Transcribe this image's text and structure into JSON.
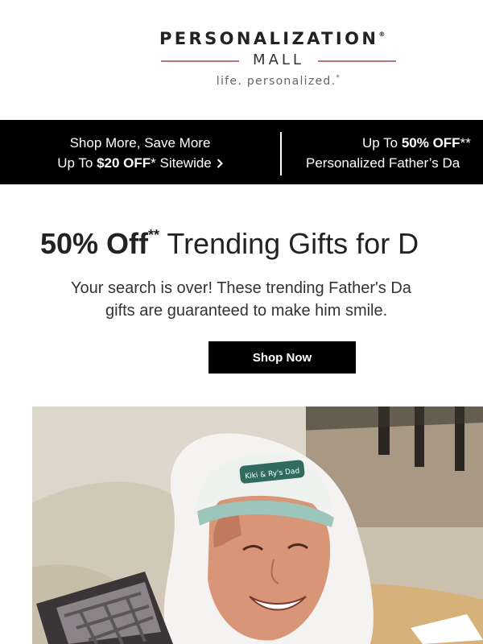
{
  "brand": {
    "name": "PERSONALIZATION",
    "registered_mark": "®",
    "sub": "MALL",
    "tagline": "life. personalized.",
    "tagline_mark": "*",
    "accent_color": "#b9707a"
  },
  "promo_bar": {
    "left_line1": "Shop More, Save More",
    "left_line2_prefix": "Up To ",
    "left_line2_bold": "$20 OFF",
    "left_line2_suffix": "* Sitewide",
    "right_line1_prefix": "Up To ",
    "right_line1_bold": "50% OFF",
    "right_line1_suffix": "**",
    "right_line2": "Personalized Father’s Da",
    "chevron_icon": "chevron-right-icon"
  },
  "hero": {
    "title_bold": "50% Off",
    "title_mark": "**",
    "title_rest": " Trending Gifts for D",
    "subtitle_line1": "Your search is over! These trending Father's Da",
    "subtitle_line2": "gifts are guaranteed to make him smile.",
    "cta_label": "Shop Now"
  },
  "photo": {
    "cap_text": "Kiki & Ry's Dad",
    "description_icon": "product-photo"
  }
}
